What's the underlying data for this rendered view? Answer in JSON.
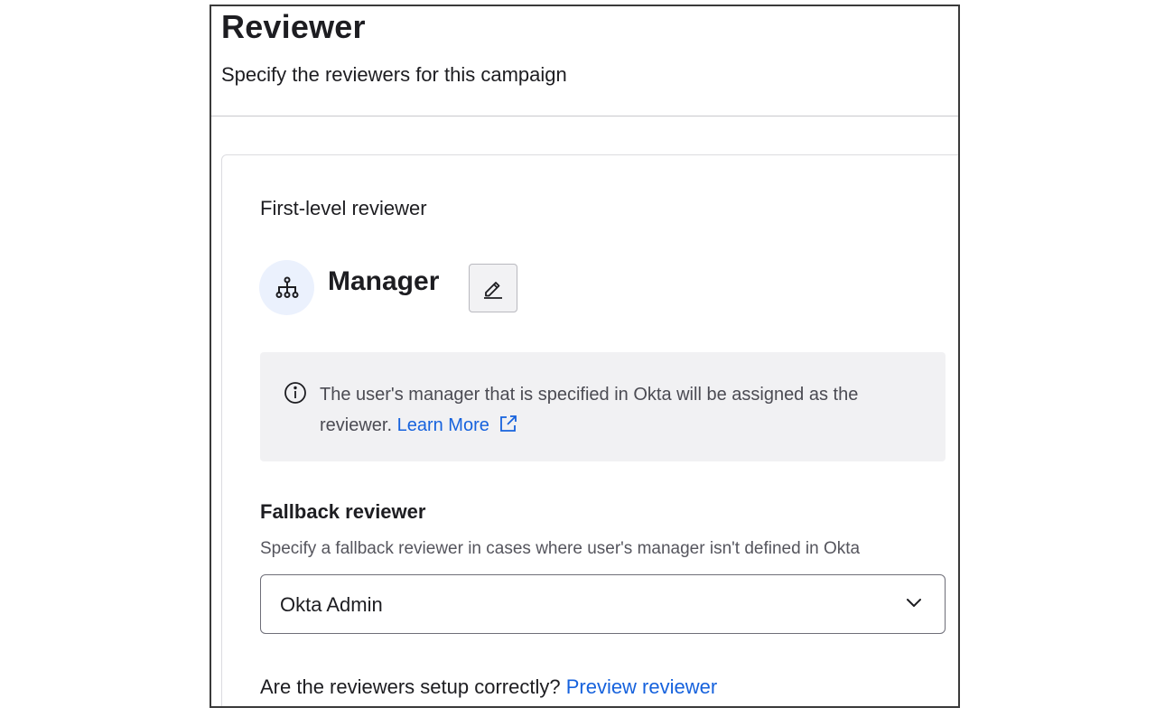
{
  "header": {
    "title": "Reviewer",
    "subtitle": "Specify the reviewers for this campaign"
  },
  "first_level": {
    "label": "First-level reviewer",
    "reviewer_icon": "org-hierarchy-icon",
    "reviewer_name": "Manager",
    "edit_icon": "pencil-icon"
  },
  "info": {
    "icon": "info-circle-icon",
    "text": "The user's manager that is specified in Okta will be assigned as the reviewer.",
    "link_label": "Learn More",
    "link_icon": "external-link-icon"
  },
  "fallback": {
    "title": "Fallback reviewer",
    "description": "Specify a fallback reviewer in cases where user's manager isn't defined in Okta",
    "selected_value": "Okta Admin",
    "chevron_icon": "chevron-down-icon"
  },
  "footer": {
    "question": "Are the reviewers setup correctly?",
    "preview_label": "Preview reviewer"
  },
  "colors": {
    "link": "#1662dd",
    "info_bg": "#f1f1f3",
    "avatar_bg": "#ebf1fd"
  }
}
